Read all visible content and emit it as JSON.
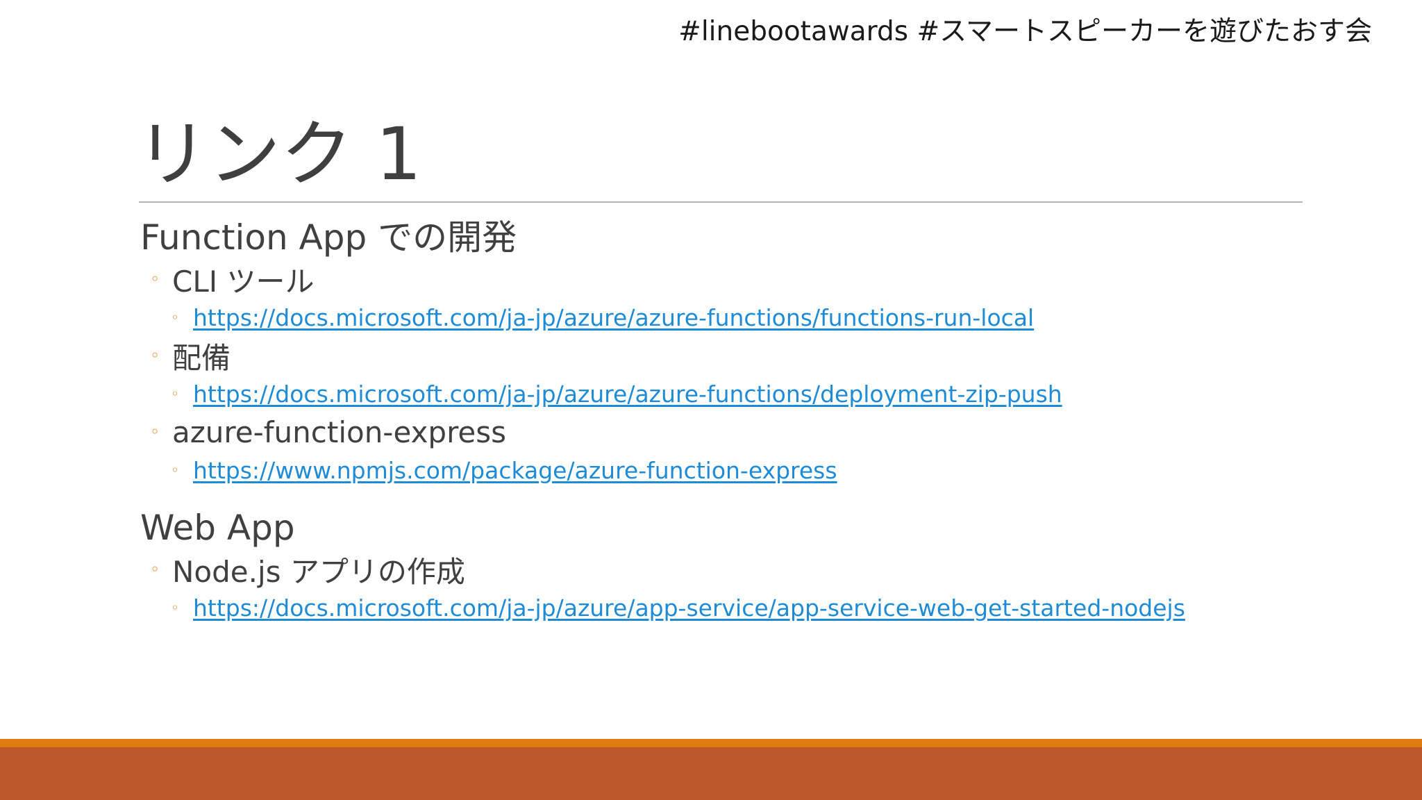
{
  "header": {
    "hashtags": "#linebootawards #スマートスピーカーを遊びたおす会"
  },
  "slide": {
    "title": "リンク 1"
  },
  "sections": [
    {
      "heading": "Function App での開発",
      "items": [
        {
          "label": "CLI ツール",
          "link": "https://docs.microsoft.com/ja-jp/azure/azure-functions/functions-run-local"
        },
        {
          "label": "配備",
          "link": "https://docs.microsoft.com/ja-jp/azure/azure-functions/deployment-zip-push"
        },
        {
          "label": "azure-function-express",
          "link": "https://www.npmjs.com/package/azure-function-express"
        }
      ]
    },
    {
      "heading": "Web App",
      "items": [
        {
          "label": "Node.js アプリの作成",
          "link": "https://docs.microsoft.com/ja-jp/azure/app-service/app-service-web-get-started-nodejs"
        }
      ]
    }
  ],
  "colors": {
    "bullet": "#e07b10",
    "link": "#1e8bd6",
    "footer_stripe": "#e07b10",
    "footer_band": "#bd582c"
  },
  "glyphs": {
    "bullet": "◦"
  }
}
